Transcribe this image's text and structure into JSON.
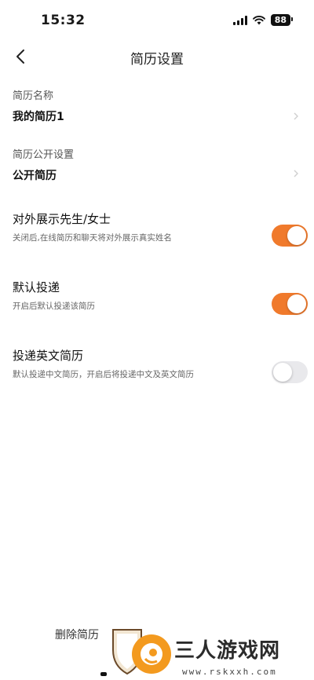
{
  "status_bar": {
    "time": "15:32",
    "battery": "88"
  },
  "nav": {
    "title": "简历设置"
  },
  "fields": [
    {
      "label": "简历名称",
      "value": "我的简历1"
    },
    {
      "label": "简历公开设置",
      "value": "公开简历"
    }
  ],
  "toggles": [
    {
      "title": "对外展示先生/女士",
      "desc": "关闭后,在线简历和聊天将对外展示真实姓名",
      "on": true
    },
    {
      "title": "默认投递",
      "desc": "开启后默认投递该简历",
      "on": true
    },
    {
      "title": "投递英文简历",
      "desc": "默认投递中文简历，开启后将投递中文及英文简历",
      "on": false
    }
  ],
  "footer": {
    "delete_label": "删除简历"
  },
  "watermark": {
    "text": "三人游戏网",
    "url": "www.rskxxh.com"
  },
  "colors": {
    "accent": "#f07a2c",
    "switch_off": "#e9e9ec"
  }
}
